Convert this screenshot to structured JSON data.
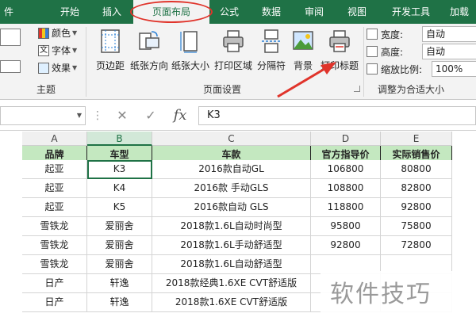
{
  "ribbon_tabs": [
    "件",
    "开始",
    "插入",
    "页面布局",
    "公式",
    "数据",
    "审阅",
    "视图",
    "开发工具",
    "加载"
  ],
  "active_tab": "页面布局",
  "theme_group": {
    "items": [
      {
        "label": "颜色",
        "icon": "colors-icon"
      },
      {
        "label": "字体",
        "icon": "font-icon"
      },
      {
        "label": "效果",
        "icon": "effects-icon"
      }
    ],
    "group_label": "主题"
  },
  "page_setup_group": {
    "buttons": [
      {
        "label": "页边距",
        "icon": "margins-icon"
      },
      {
        "label": "纸张方向",
        "icon": "orientation-icon"
      },
      {
        "label": "纸张大小",
        "icon": "size-icon"
      },
      {
        "label": "打印区域",
        "icon": "print-area-icon"
      },
      {
        "label": "分隔符",
        "icon": "breaks-icon"
      },
      {
        "label": "背景",
        "icon": "background-icon"
      },
      {
        "label": "打印标题",
        "icon": "print-titles-icon"
      }
    ],
    "group_label": "页面设置"
  },
  "scale_group": {
    "rows": [
      {
        "label": "宽度:",
        "value": "自动"
      },
      {
        "label": "高度:",
        "value": "自动"
      },
      {
        "label": "缩放比例:",
        "value": "100%"
      }
    ],
    "group_label": "调整为合适大小"
  },
  "formula_bar": {
    "name_box": "",
    "cancel_glyph": "✕",
    "enter_glyph": "✓",
    "fx_glyph": "fx",
    "content": "K3"
  },
  "columns": [
    "A",
    "B",
    "C",
    "D",
    "E"
  ],
  "table": {
    "headers": [
      "品牌",
      "车型",
      "车款",
      "官方指导价",
      "实际销售价"
    ],
    "rows": [
      [
        "起亚",
        "K3",
        "2016款自动GL",
        "106800",
        "80800"
      ],
      [
        "起亚",
        "K4",
        "2016款  手动GLS",
        "108800",
        "82800"
      ],
      [
        "起亚",
        "K5",
        "2016款自动  GLS",
        "118800",
        "92800"
      ],
      [
        "雪铁龙",
        "爱丽舍",
        "2018款1.6L自动时尚型",
        "95800",
        "75800"
      ],
      [
        "雪铁龙",
        "爱丽舍",
        "2018款1.6L手动舒适型",
        "92800",
        "72800"
      ],
      [
        "雪铁龙",
        "爱丽舍",
        "2018款1.6L自动舒适型",
        "",
        ""
      ],
      [
        "日产",
        "轩逸",
        "2018款经典1.6XE CVT舒适版",
        "",
        ""
      ],
      [
        "日产",
        "轩逸",
        "2018款1.6XE CVT舒适版",
        "",
        ""
      ]
    ]
  },
  "watermark": "软件技巧",
  "colors": {
    "ribbon_green": "#1f7246",
    "header_fill": "#c4e8c0",
    "annotation_red": "#e0342b"
  }
}
